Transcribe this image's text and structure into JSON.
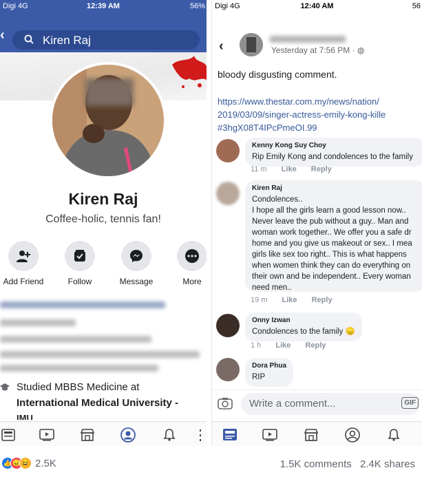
{
  "left": {
    "status": {
      "carrier": "Digi 4G",
      "time": "12:39 AM",
      "battery": "56%"
    },
    "search": {
      "query": "Kiren Raj"
    },
    "profile": {
      "name": "Kiren Raj",
      "bio": "Coffee-holic, tennis fan!"
    },
    "actions": [
      {
        "label": "Add Friend",
        "icon": "add-friend-icon"
      },
      {
        "label": "Follow",
        "icon": "follow-icon"
      },
      {
        "label": "Message",
        "icon": "messenger-icon"
      },
      {
        "label": "More",
        "icon": "more-icon"
      }
    ],
    "education": {
      "line1": "Studied MBBS Medicine at",
      "line2": "International Medical University -",
      "line3": "IMU"
    }
  },
  "right": {
    "status": {
      "carrier": "Digi 4G",
      "time": "12:40 AM",
      "battery": "56"
    },
    "post": {
      "time": "Yesterday at 7:56 PM ·",
      "text": "bloody disgusting comment.",
      "link1": "https://www.thestar.com.my/news/nation/",
      "link2": "2019/03/09/singer-actress-emily-kong-kille",
      "link3": "#3hgX08T4IPcPmeOI.99"
    },
    "comments": [
      {
        "name": "Kenny Kong Suy Choy",
        "text": "Rip Emily Kong and condolences to the family",
        "time": "11 m",
        "like": "Like",
        "reply": "Reply"
      },
      {
        "name": "Kiren Raj",
        "text": "Condolences..\nI hope all the girls learn a good  lesson now..\nNever leave the pub without a guy.. Man and\nwoman work together.. We offer you a safe dr\nhome and you give us makeout or sex.. I mea\ngirls like sex too right.. This is what happens\nwhen women think they can do everything on\ntheir own and be independent.. Every woman\nneed men..",
        "time": "19 m",
        "like": "Like",
        "reply": "Reply"
      },
      {
        "name": "Onny Izwan",
        "text": "Condolences to the family 😞",
        "time": "1 h",
        "like": "Like",
        "reply": "Reply"
      },
      {
        "name": "Dora Phua",
        "text": "RIP"
      }
    ],
    "composer": {
      "placeholder": "Write a comment...",
      "gif": "GIF"
    }
  },
  "stats": {
    "reactions": "2.5K",
    "comments": "1.5K comments",
    "shares": "2.4K shares"
  },
  "colors": {
    "fb_blue": "#3b5ba9",
    "link": "#365899",
    "bubble": "#f0f2f5"
  }
}
